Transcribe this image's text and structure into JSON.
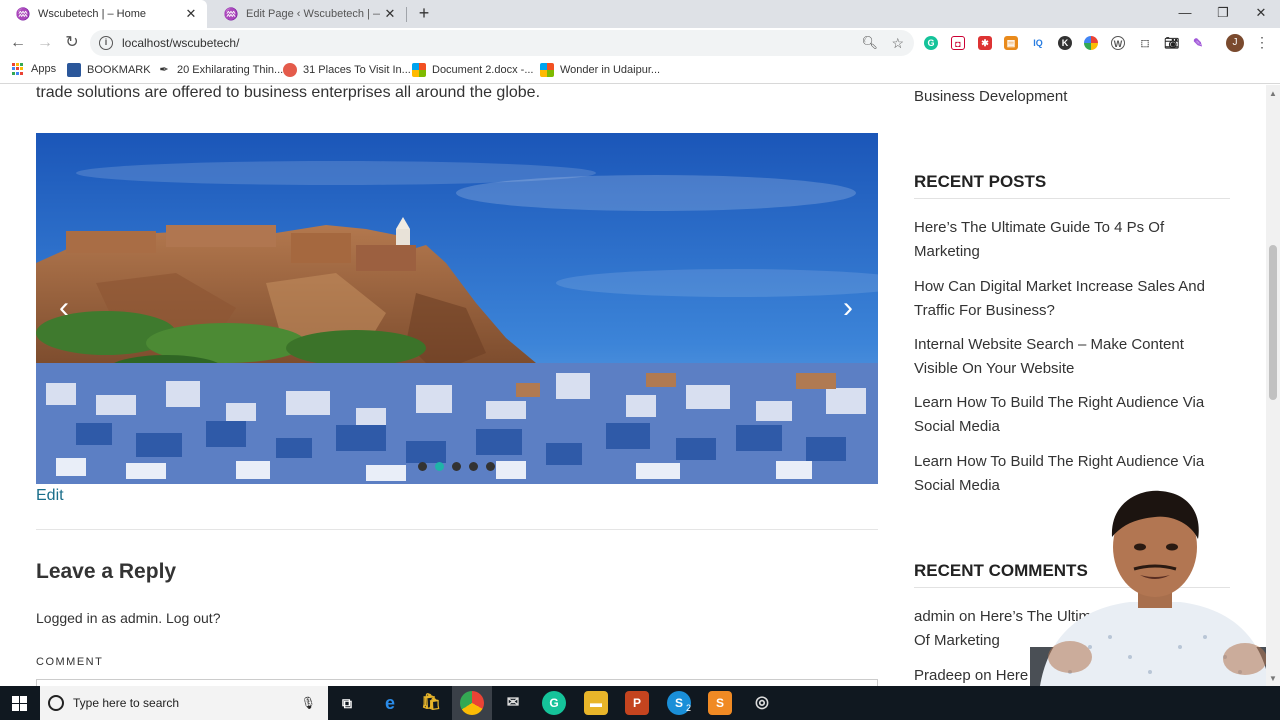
{
  "browser": {
    "tabs": [
      {
        "title": "Wscubetech | – Home",
        "active": true
      },
      {
        "title": "Edit Page ‹ Wscubetech | — Wor",
        "active": false
      }
    ],
    "url": "localhost/wscubetech/",
    "bookmarks": [
      {
        "label": "Apps"
      },
      {
        "label": "BOOKMARK"
      },
      {
        "label": "20 Exhilarating Thin..."
      },
      {
        "label": "31 Places To Visit In..."
      },
      {
        "label": "Document 2.docx -..."
      },
      {
        "label": "Wonder in Udaipur..."
      }
    ],
    "profile_initial": "J"
  },
  "page": {
    "intro_text": "trade solutions are offered to business enterprises all around the globe.",
    "slider": {
      "dot_count": 5,
      "active_dot": 1
    },
    "edit_link": "Edit",
    "reply_title": "Leave a Reply",
    "logged_in_text": "Logged in as admin. Log out?",
    "comment_label": "COMMENT"
  },
  "sidebar": {
    "top_link": "Business Development",
    "recent_posts_heading": "RECENT POSTS",
    "recent_posts": [
      "Here’s The Ultimate Guide To 4 Ps Of Marketing",
      "How Can Digital Market Increase Sales And Traffic For Business?",
      "Internal Website Search – Make Content Visible On Your Website",
      "Learn How To Build The Right Audience Via Social Media",
      "Learn How To Build The Right Audience Via Social Media"
    ],
    "recent_comments_heading": "RECENT COMMENTS",
    "recent_comments": [
      "admin on Here’s The Ultimate Guide To 4 Ps Of Marketing",
      "Pradeep on Here"
    ]
  },
  "taskbar": {
    "search_placeholder": "Type here to search",
    "skype_badge": "2"
  },
  "colors": {
    "link": "#1a6e8a",
    "active_dot": "#1fb4a8",
    "taskbar": "#101820"
  }
}
